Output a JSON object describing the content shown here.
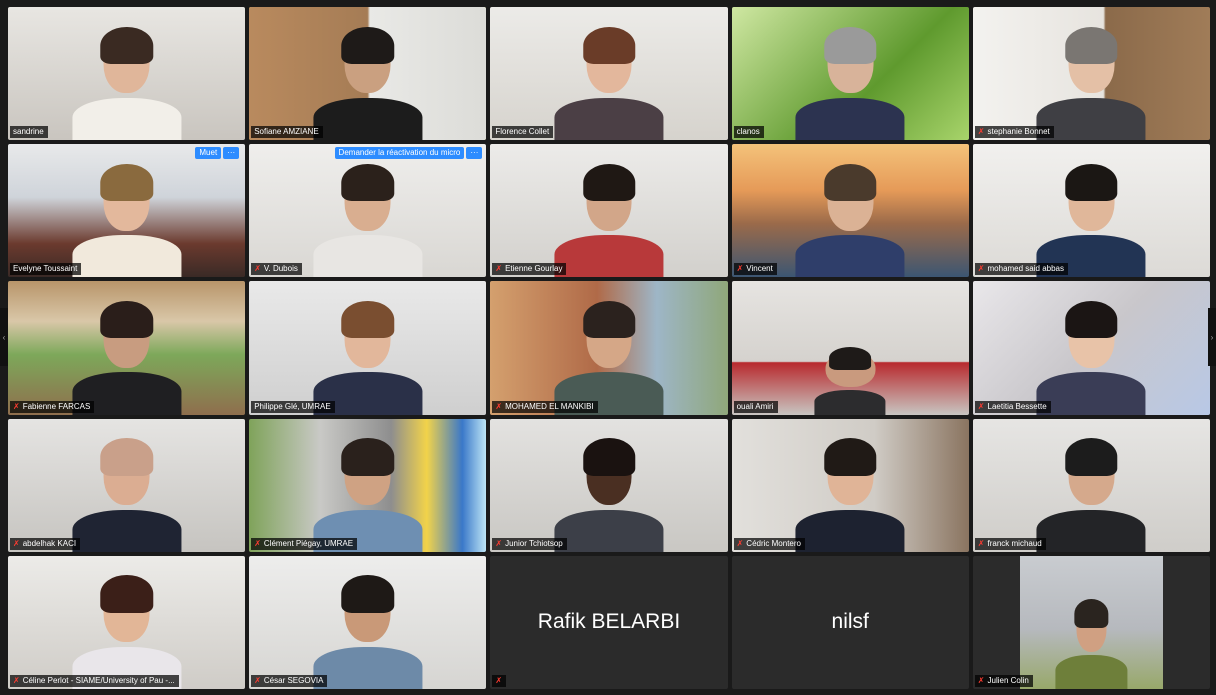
{
  "participants": [
    {
      "name": "sandrine"
    },
    {
      "name": "Sofiane AMZIANE"
    },
    {
      "name": "Florence Collet"
    },
    {
      "name": "clanos"
    },
    {
      "name": "stephanie Bonnet"
    },
    {
      "name": "Evelyne Toussaint"
    },
    {
      "name": "V. Dubois"
    },
    {
      "name": "Etienne Gourlay"
    },
    {
      "name": "Vincent"
    },
    {
      "name": "mohamed said abbas"
    },
    {
      "name": "Fabienne FARCAS"
    },
    {
      "name": "Philippe Glé, UMRAE"
    },
    {
      "name": "MOHAMED EL MANKIBI"
    },
    {
      "name": "ouali Amiri"
    },
    {
      "name": "Laetitia Bessette"
    },
    {
      "name": "abdelhak KACI"
    },
    {
      "name": "Clément Piégay, UMRAE"
    },
    {
      "name": "Junior Tchiotsop"
    },
    {
      "name": "Cédric Montero"
    },
    {
      "name": "franck michaud"
    },
    {
      "name": "Céline Perlot - SIAME/University of Pau -..."
    },
    {
      "name": "César SEGOVIA"
    },
    {
      "name": "Rafik BELARBI"
    },
    {
      "name": "nilsf"
    },
    {
      "name": "Julien Colin"
    }
  ],
  "badges": {
    "muet": "Muet",
    "more": "···",
    "request_unmute": "Demander la réactivation du micro"
  },
  "colors": {
    "speaking_outline": "#d9e35a",
    "muted_mic": "#ff3b30",
    "zoom_blue": "#2d8cff"
  }
}
